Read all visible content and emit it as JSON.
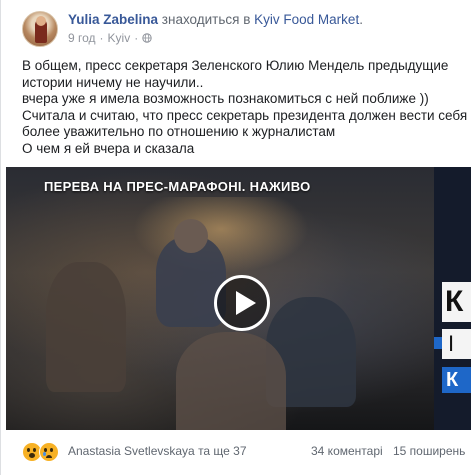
{
  "post": {
    "author": "Yulia Zabelina",
    "location_prefix": "знаходиться в",
    "location": "Kyiv Food Market",
    "location_suffix": ".",
    "time": "9 год",
    "separator": "·",
    "city": "Kyiv",
    "privacy_icon": "globe-icon",
    "text_lines": [
      "В общем, пресс секретаря Зеленского Юлию Мендель предыдущие",
      "истории ничему не научили..",
      "вчера уже я имела возможность познакомиться с ней поближе ))",
      "Считала и считаю, что пресс секретарь президента должен вести себя",
      "более уважительно по отношению к журналистам",
      "О чем я ей вчера и сказала"
    ]
  },
  "video": {
    "caption": "ПЕРЕВА НА ПРЕС-МАРАФОНІ. НАЖИВО",
    "side_text_1": "К",
    "side_text_2": "І К",
    "side_text_3": "К",
    "play_icon": "play-icon"
  },
  "footer": {
    "reactions": [
      "wow",
      "sad"
    ],
    "reactors": "Anastasia Svetlevskaya та ще 37",
    "comments": "34 коментарі",
    "shares": "15 поширень"
  },
  "colors": {
    "link": "#385898",
    "meta": "#90949c",
    "text": "#1c1e21",
    "video_accent": "#1e67c8"
  }
}
